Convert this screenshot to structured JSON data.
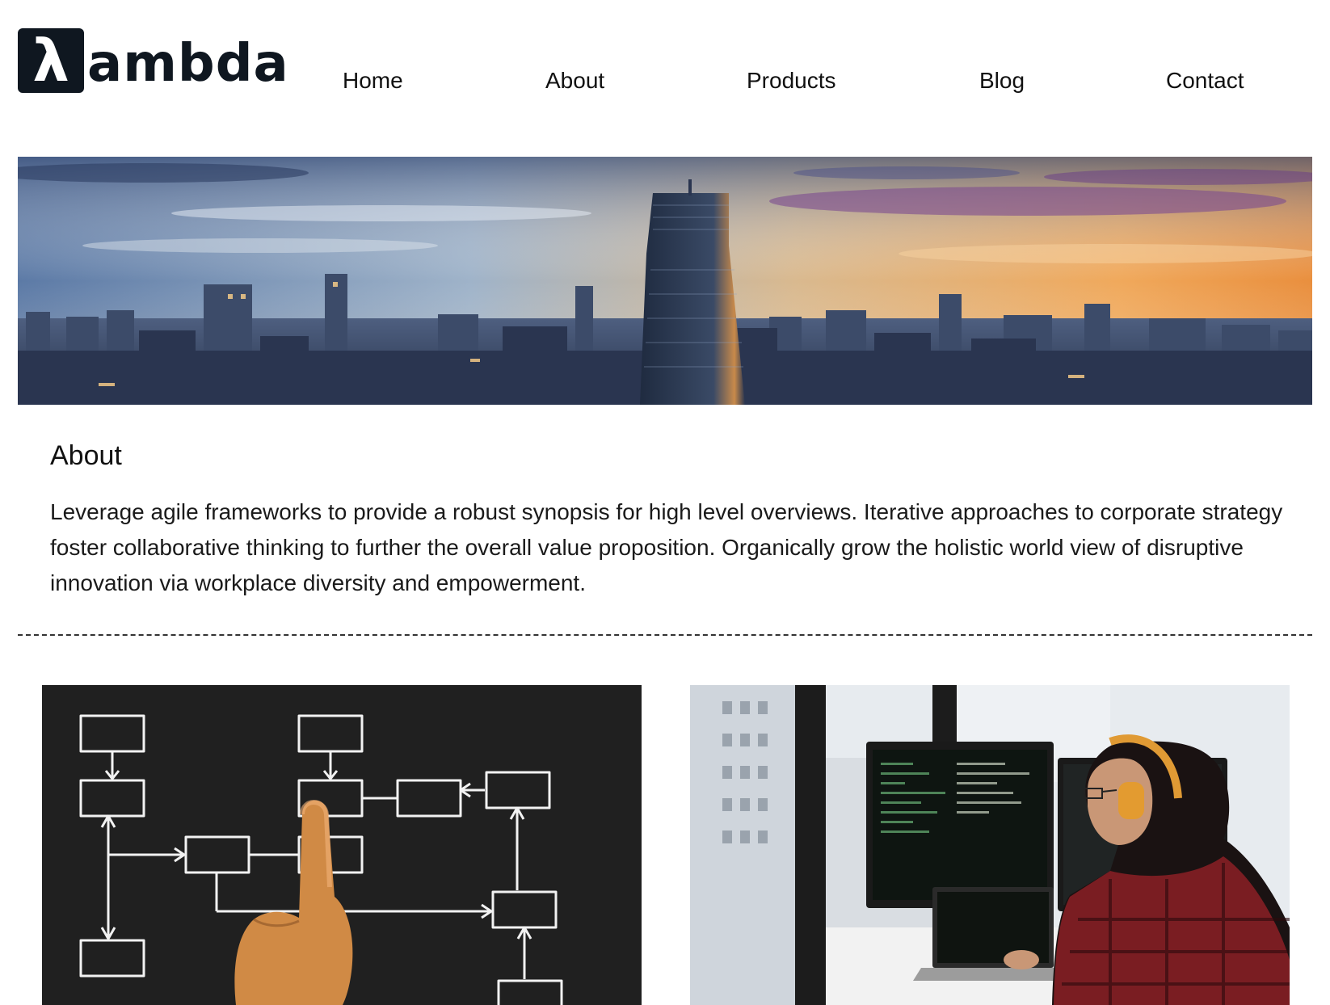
{
  "brand": {
    "logo_symbol": "λ",
    "logo_text": "ambda"
  },
  "nav": {
    "items": [
      "Home",
      "About",
      "Products",
      "Blog",
      "Contact"
    ]
  },
  "hero": {
    "image": "city-skyline-sunset"
  },
  "about": {
    "title": "About",
    "body": "Leverage agile frameworks to provide a robust synopsis for high level overviews. Iterative approaches to corporate strategy foster collaborative thinking to further the overall value proposition. Organically grow the holistic world view of disruptive innovation via workplace diversity and empowerment."
  },
  "cards": [
    {
      "image": "flowchart-on-chalkboard-with-finger"
    },
    {
      "image": "developer-with-headphones-at-monitors"
    }
  ],
  "colors": {
    "text": "#111111",
    "logo": "#0f1720",
    "divider": "#333333"
  }
}
